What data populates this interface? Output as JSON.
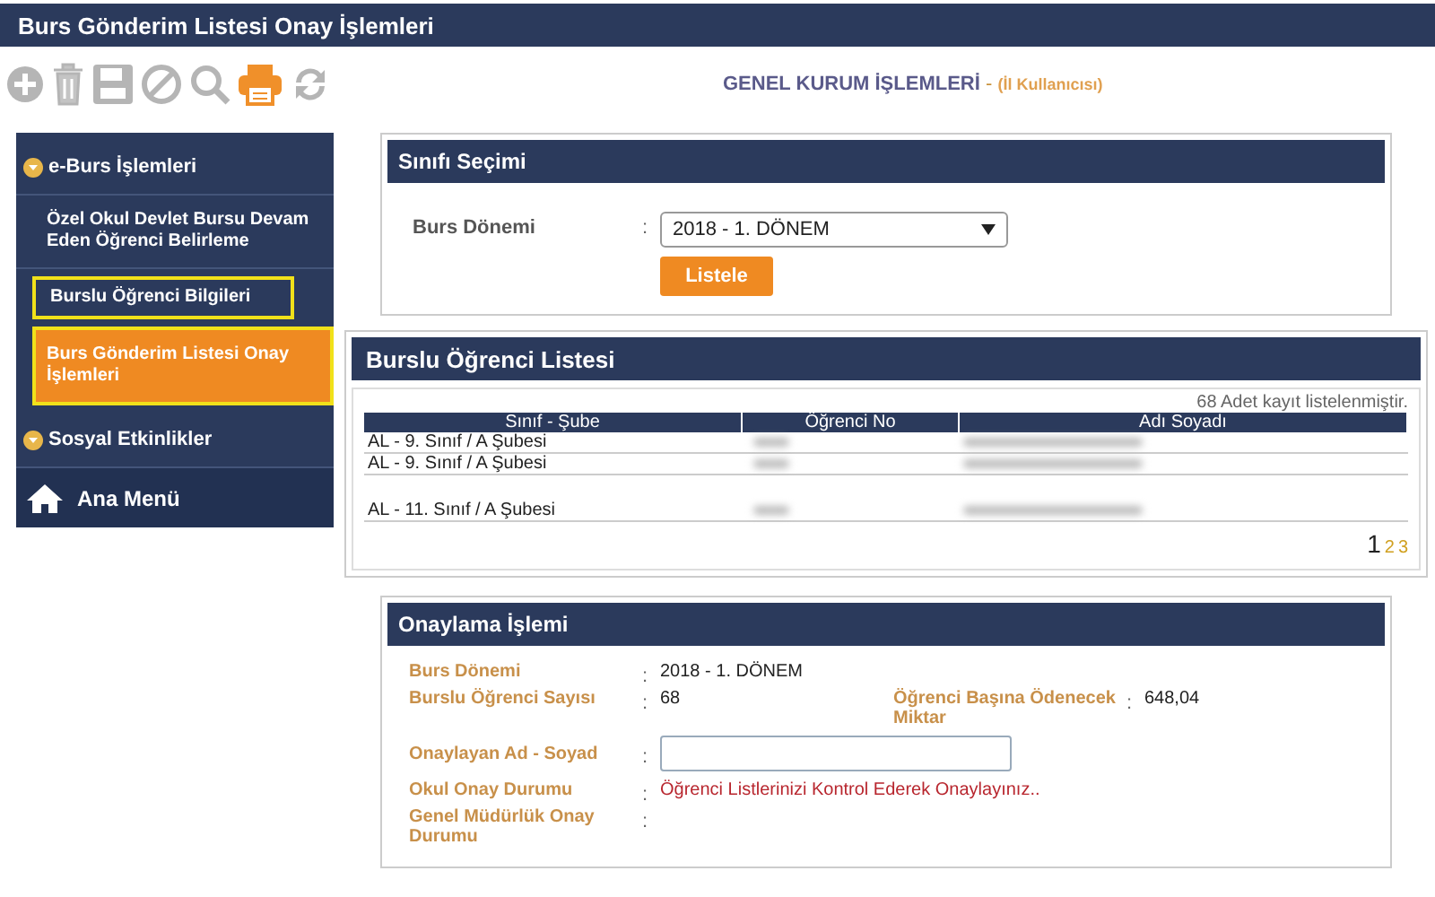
{
  "window": {
    "title": "Burs Gönderim Listesi Onay İşlemleri"
  },
  "toolbar": {
    "heading": "GENEL KURUM İŞLEMLERİ",
    "separator": "-",
    "role": "(İl Kullanıcısı)"
  },
  "sidebar": {
    "groups": [
      {
        "label": "e-Burs İşlemleri",
        "items": [
          {
            "label": "Özel Okul Devlet Bursu Devam Eden Öğrenci Belirleme",
            "selected": false,
            "outlined": false
          },
          {
            "label": "Burslu Öğrenci Bilgileri",
            "selected": false,
            "outlined": true
          },
          {
            "label": "Burs Gönderim Listesi Onay İşlemleri",
            "selected": true,
            "outlined": true
          }
        ]
      },
      {
        "label": "Sosyal Etkinlikler"
      }
    ],
    "home": "Ana Menü"
  },
  "class_selection": {
    "title": "Sınıfı Seçimi",
    "label": "Burs Dönemi",
    "colon": ":",
    "value": "2018 - 1. DÖNEM",
    "button": "Listele"
  },
  "student_list": {
    "title": "Burslu Öğrenci Listesi",
    "count": "68 Adet kayıt listelenmiştir.",
    "columns": [
      "Sınıf - Şube",
      "Öğrenci No",
      "Adı Soyadı"
    ],
    "rows": [
      {
        "class": "AL - 9. Sınıf / A Şubesi"
      },
      {
        "class": "AL - 9. Sınıf / A Şubesi"
      },
      {
        "class": "AL - 11. Sınıf / A Şubesi"
      }
    ],
    "pages": [
      {
        "label": "1",
        "selected": true
      },
      {
        "label": "2",
        "selected": false
      },
      {
        "label": "3",
        "selected": false
      }
    ]
  },
  "approval": {
    "title": "Onaylama İşlemi",
    "fields": [
      {
        "kind": "text",
        "label": "Burs Dönemi",
        "value": "2018 - 1. DÖNEM"
      },
      {
        "kind": "pair",
        "label": "Burslu Öğrenci Sayısı",
        "value": "68",
        "label2": "Öğrenci Başına Ödenecek Miktar",
        "value2": "648,04"
      },
      {
        "kind": "input",
        "label": "Onaylayan Ad - Soyad"
      },
      {
        "kind": "status",
        "label": "Okul Onay Durumu",
        "value": "Öğrenci Listlerinizi Kontrol Ederek Onaylayınız.."
      },
      {
        "kind": "text",
        "label": "Genel Müdürlük Onay Durumu"
      }
    ]
  }
}
